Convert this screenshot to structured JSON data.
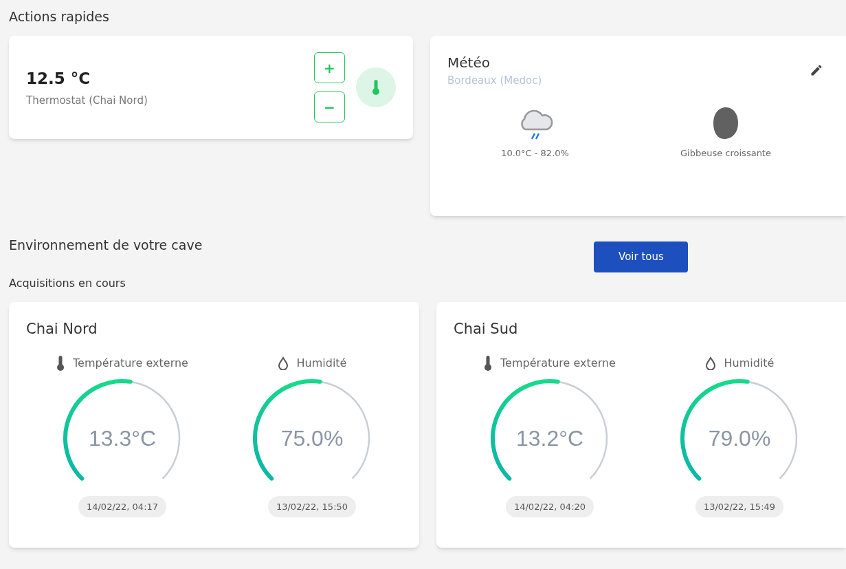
{
  "quick_actions": {
    "title": "Actions rapides",
    "thermostat": {
      "value": "12.5 °C",
      "label": "Thermostat (Chai Nord)",
      "plus": "+",
      "minus": "−"
    },
    "weather": {
      "title": "Météo",
      "location": "Bordeaux (Medoc)",
      "conditions": "10.0°C - 82.0%",
      "moon": "Gibbeuse croissante"
    }
  },
  "environment": {
    "title": "Environnement de votre cave",
    "button": "Voir tous",
    "subtitle": "Acquisitions en cours",
    "cellars": [
      {
        "name": "Chai Nord",
        "sensors": [
          {
            "kind": "temperature",
            "label": "Température externe",
            "reading": "13.3°C",
            "timestamp": "14/02/22, 04:17"
          },
          {
            "kind": "humidity",
            "label": "Humidité",
            "reading": "75.0%",
            "timestamp": "13/02/22, 15:50"
          }
        ]
      },
      {
        "name": "Chai Sud",
        "sensors": [
          {
            "kind": "temperature",
            "label": "Température externe",
            "reading": "13.2°C",
            "timestamp": "14/02/22, 04:20"
          },
          {
            "kind": "humidity",
            "label": "Humidité",
            "reading": "79.0%",
            "timestamp": "13/02/22, 15:49"
          }
        ]
      }
    ]
  }
}
